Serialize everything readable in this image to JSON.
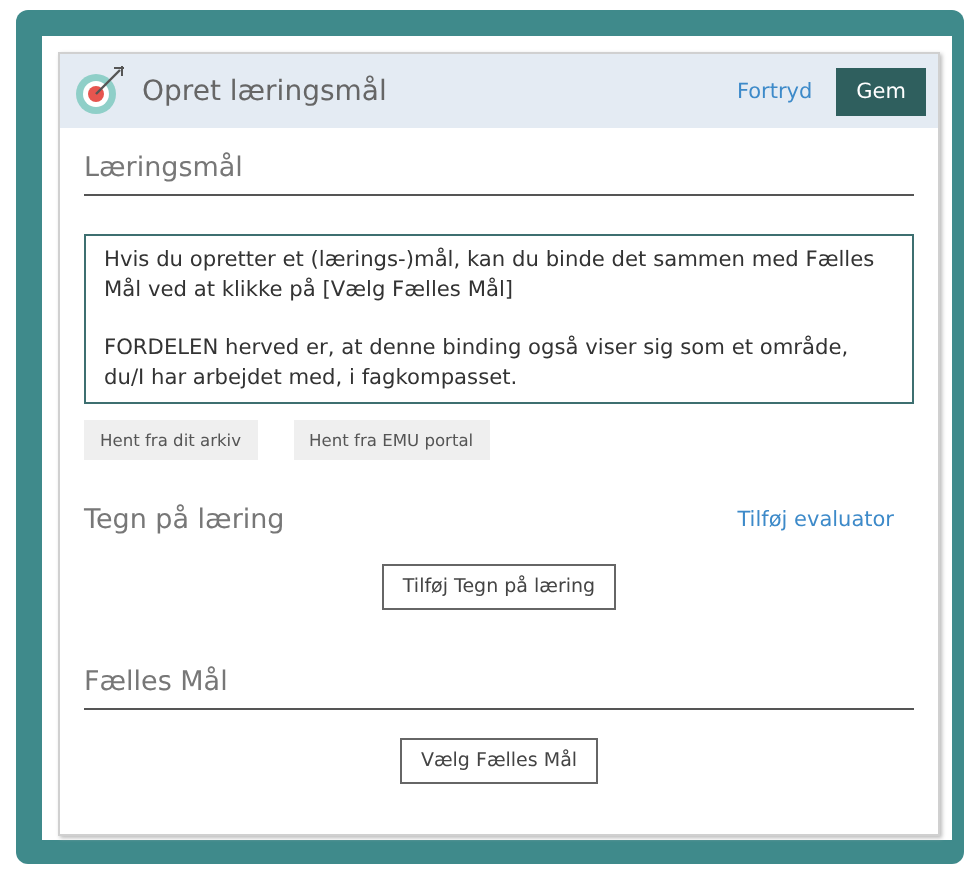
{
  "header": {
    "title": "Opret læringsmål",
    "cancel": "Fortryd",
    "save": "Gem"
  },
  "goal": {
    "label": "Læringsmål",
    "paragraphs": [
      "Hvis du opretter et (lærings-)mål, kan du binde det sammen med Fælles Mål ved at klikke på [Vælg Fælles Mål]",
      "FORDELEN herved er, at denne binding også viser sig som et område, du/I har arbejdet med, i  fagkompasset."
    ],
    "buttons": [
      "Hent fra dit arkiv",
      "Hent fra EMU portal"
    ]
  },
  "signs": {
    "title": "Tegn på læring",
    "link": "Tilføj evaluator",
    "button": "Tilføj Tegn på læring"
  },
  "common_goals": {
    "label": "Fælles Mål",
    "button": "Vælg Fælles Mål"
  }
}
